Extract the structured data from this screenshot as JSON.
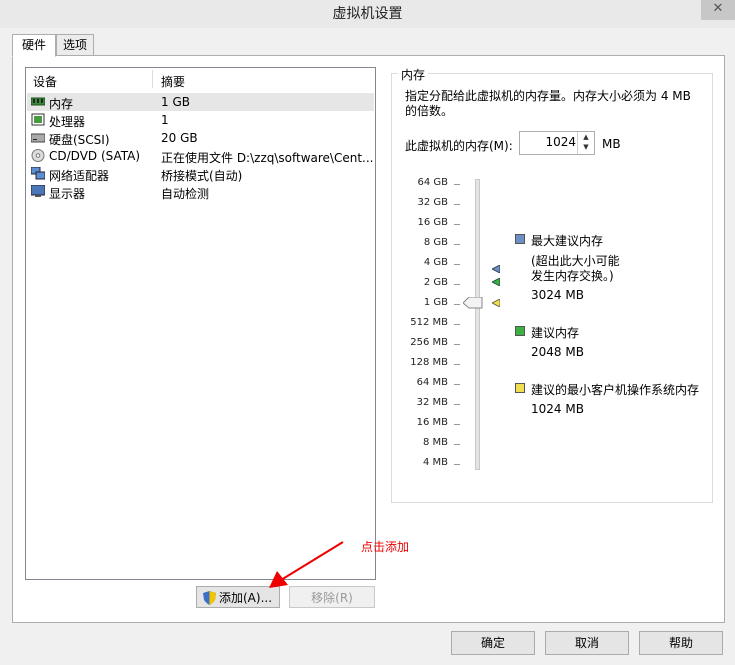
{
  "window": {
    "title": "虚拟机设置",
    "close_glyph": "✕"
  },
  "tabs": [
    {
      "label": "硬件"
    },
    {
      "label": "选项"
    }
  ],
  "device_list": {
    "headers": {
      "device": "设备",
      "summary": "摘要"
    },
    "rows": [
      {
        "name": "内存",
        "summary": "1 GB",
        "icon": "memory-icon",
        "selected": true
      },
      {
        "name": "处理器",
        "summary": "1",
        "icon": "processor-icon"
      },
      {
        "name": "硬盘(SCSI)",
        "summary": "20 GB",
        "icon": "hard-disk-icon"
      },
      {
        "name": "CD/DVD (SATA)",
        "summary": "正在使用文件 D:\\zzq\\software\\Cent...",
        "icon": "cd-dvd-icon"
      },
      {
        "name": "网络适配器",
        "summary": "桥接模式(自动)",
        "icon": "network-adapter-icon"
      },
      {
        "name": "显示器",
        "summary": "自动检测",
        "icon": "display-icon"
      }
    ],
    "add_label": "添加(A)...",
    "remove_label": "移除(R)"
  },
  "memory": {
    "group_title": "内存",
    "description": "指定分配给此虚拟机的内存量。内存大小必须为 4 MB 的倍数。",
    "field_label": "此虚拟机的内存(M):",
    "value": "1024",
    "unit": "MB",
    "scale_labels": [
      "64 GB",
      "32 GB",
      "16 GB",
      "8 GB",
      "4 GB",
      "2 GB",
      "1 GB",
      "512 MB",
      "256 MB",
      "128 MB",
      "64 MB",
      "32 MB",
      "16 MB",
      "8 MB",
      "4 MB"
    ],
    "legend": {
      "max": {
        "title": "最大建议内存",
        "note1": "(超出此大小可能",
        "note2": "发生内存交换。)",
        "value": "3024 MB",
        "color": "#6d8fc4"
      },
      "recommended": {
        "title": "建议内存",
        "value": "2048 MB",
        "color": "#3cb043"
      },
      "min": {
        "title": "建议的最小客户机操作系统内存",
        "value": "1024 MB",
        "color": "#f0e050"
      }
    }
  },
  "annotation": "点击添加",
  "buttons": {
    "ok": "确定",
    "cancel": "取消",
    "help": "帮助"
  }
}
